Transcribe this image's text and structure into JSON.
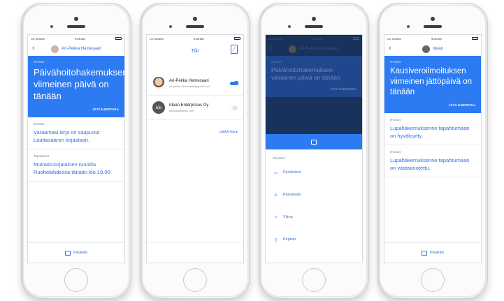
{
  "phone1": {
    "status": {
      "carrier": "•••• Sonera",
      "time": "9:08 AM"
    },
    "nav_title": "Ari-Pekka Hemesaari",
    "hero": {
      "category": "Ilmoitus",
      "text": "Päivähoitohakemuksen viimeinen päivä on tänään",
      "cta": "JÄTÄ ILMOITUS ▸"
    },
    "cards": [
      {
        "category": "Ilmoitus",
        "text": "Varaamasi kirja on saapunut Lauttasaaren kirjastoon."
      },
      {
        "category": "Tapahtuma",
        "text": "Muinaisnorjalainen runoilta Ruoholahdessa tänään klo 19.00"
      }
    ],
    "footer_label": "Pikalinkit"
  },
  "phone2": {
    "status": {
      "carrier": "•••• Sonera",
      "time": "9:08 AM"
    },
    "title": "Tilit",
    "accounts": [
      {
        "name": "Ari-Pekka Hemesaari",
        "email": "ari-pekka.hemesaari@gmail.com",
        "active": true
      },
      {
        "name": "Idean Enterprises Oy",
        "email": "ideanid@idean.com",
        "active": false
      }
    ],
    "add_account": "LISÄÄ TILI ▸"
  },
  "phone3": {
    "status": {
      "carrier": "•••• Sonera",
      "time": "9:08 AM"
    },
    "nav_title": "Ari-Pekka Hemesaari",
    "hero": {
      "category": "Ilmoitus",
      "text": "Päivähoitohakemuksen viimeinen päivä on tänään",
      "cta": "JÄTÄ ILMOITUS ▸"
    },
    "menu_header": "Pikalinkit",
    "menu_items": [
      {
        "icon": "bus-icon",
        "glyph": "▭",
        "label": "Pysäköinti"
      },
      {
        "icon": "people-icon",
        "glyph": "♙",
        "label": "Päivähoito"
      },
      {
        "icon": "sun-icon",
        "glyph": "☼",
        "label": "Vilma"
      },
      {
        "icon": "book-icon",
        "glyph": "▯",
        "label": "Kirjasto"
      }
    ]
  },
  "phone4": {
    "status": {
      "carrier": "•••• Sonera",
      "time": "9:08 AM"
    },
    "nav_title": "Idean",
    "hero": {
      "category": "Ilmoitus",
      "text": "Kausiveroilmoituksen viimeinen jättöpäivä on tänään",
      "cta": "JÄTÄ ILMOITUS ▸"
    },
    "cards": [
      {
        "category": "Ilmoitus",
        "text": "Lupahakemuksenne tapahtumaan on hyväksytty."
      },
      {
        "category": "Ilmoitus",
        "text": "Lupahakemuksenne tapahtumaan on vastaanotettu."
      }
    ],
    "footer_label": "Pikalinkit"
  },
  "colors": {
    "accent": "#2d7bf2",
    "link": "#2d6fe6"
  }
}
